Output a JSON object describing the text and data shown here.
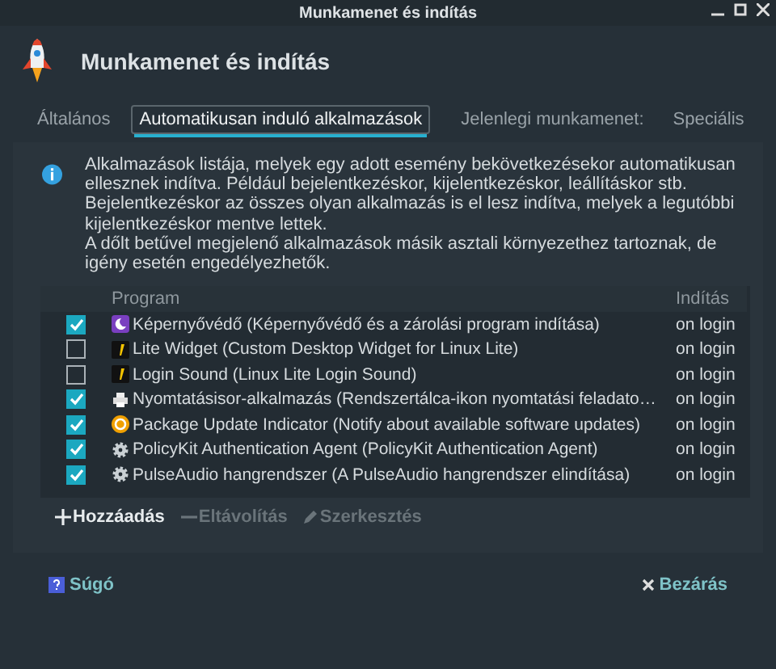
{
  "window": {
    "title": "Munkamenet és indítás"
  },
  "header": {
    "title": "Munkamenet és indítás"
  },
  "tabs": [
    {
      "label": "Általános",
      "selected": false
    },
    {
      "label": "Automatikusan induló alkalmazások",
      "selected": true
    },
    {
      "label": "Jelenlegi munkamenet:",
      "selected": false
    },
    {
      "label": "Speciális",
      "selected": false
    }
  ],
  "info": {
    "lines": [
      "Alkalmazások listája, melyek egy adott esemény bekövetkezésekor automatikusan ellesznek indítva. Például bejelentkezéskor, kijelentkezéskor, leállításkor stb.",
      "Bejelentkezéskor az összes olyan alkalmazás is el lesz indítva, melyek a legutóbbi kijelentkezéskor mentve lettek.",
      "A dőlt betűvel megjelenő alkalmazások másik asztali környezethez tartoznak, de igény esetén engedélyezhetők."
    ]
  },
  "table": {
    "columns": [
      "Program",
      "Indítás"
    ],
    "rows": [
      {
        "program": "Képernyővédő (Képernyővédő és a zárolási program indítása)",
        "trigger": "on login",
        "checked": true,
        "kind": "screensaver"
      },
      {
        "program": "Lite Widget (Custom Desktop Widget for Linux Lite)",
        "trigger": "on login",
        "checked": false,
        "kind": "lite"
      },
      {
        "program": "Login Sound (Linux Lite Login Sound)",
        "trigger": "on login",
        "checked": false,
        "kind": "lite"
      },
      {
        "program": "Nyomtatásisor-alkalmazás (Rendszertálca-ikon nyomtatási feladato…",
        "trigger": "on login",
        "checked": true,
        "kind": "printer"
      },
      {
        "program": "Package Update Indicator (Notify about available software updates)",
        "trigger": "on login",
        "checked": true,
        "kind": "update"
      },
      {
        "program": "PolicyKit Authentication Agent (PolicyKit Authentication Agent)",
        "trigger": "on login",
        "checked": true,
        "kind": "gear"
      },
      {
        "program": "PulseAudio hangrendszer (A PulseAudio hangrendszer elindítása)",
        "trigger": "on login",
        "checked": true,
        "kind": "gear"
      }
    ]
  },
  "toolbar": [
    {
      "label": "Hozzáadás",
      "kind": "add",
      "disabled": false
    },
    {
      "label": "Eltávolítás",
      "kind": "remove",
      "disabled": true
    },
    {
      "label": "Szerkesztés",
      "kind": "edit",
      "disabled": true
    }
  ],
  "footer": {
    "help": "Súgó",
    "close": "Bezárás"
  }
}
